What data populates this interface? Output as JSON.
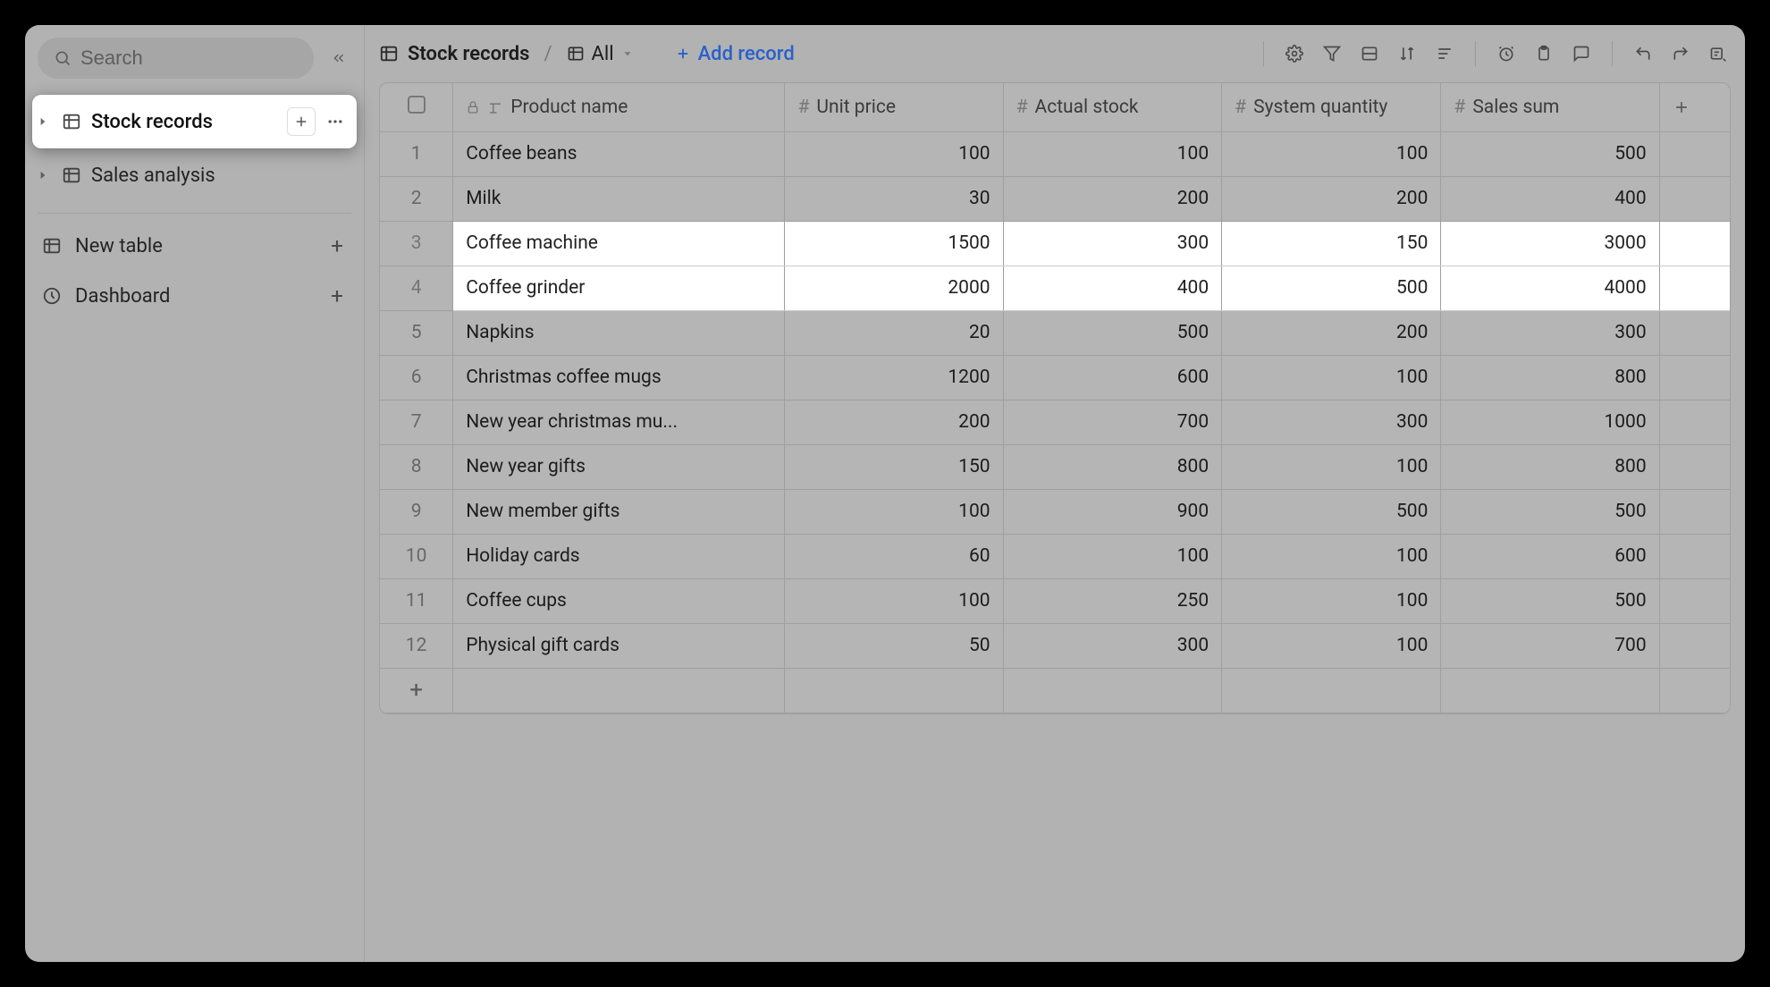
{
  "sidebar": {
    "search_placeholder": "Search",
    "items": [
      {
        "label": "Stock records"
      },
      {
        "label": "Sales analysis"
      }
    ],
    "new_table": "New table",
    "dashboard": "Dashboard"
  },
  "toolbar": {
    "title": "Stock records",
    "view": "All",
    "add_record": "Add record"
  },
  "table": {
    "columns": [
      {
        "label": "Product name"
      },
      {
        "label": "Unit price"
      },
      {
        "label": "Actual stock"
      },
      {
        "label": "System quantity"
      },
      {
        "label": "Sales sum"
      }
    ],
    "rows": [
      {
        "n": "1",
        "name": "Coffee beans",
        "unit": "100",
        "actual": "100",
        "system": "100",
        "sales": "500",
        "hl": false
      },
      {
        "n": "2",
        "name": "Milk",
        "unit": "30",
        "actual": "200",
        "system": "200",
        "sales": "400",
        "hl": false
      },
      {
        "n": "3",
        "name": "Coffee machine",
        "unit": "1500",
        "actual": "300",
        "system": "150",
        "sales": "3000",
        "hl": true
      },
      {
        "n": "4",
        "name": "Coffee grinder",
        "unit": "2000",
        "actual": "400",
        "system": "500",
        "sales": "4000",
        "hl": true
      },
      {
        "n": "5",
        "name": "Napkins",
        "unit": "20",
        "actual": "500",
        "system": "200",
        "sales": "300",
        "hl": false
      },
      {
        "n": "6",
        "name": "Christmas coffee mugs",
        "unit": "1200",
        "actual": "600",
        "system": "100",
        "sales": "800",
        "hl": false
      },
      {
        "n": "7",
        "name": "New year christmas mu...",
        "unit": "200",
        "actual": "700",
        "system": "300",
        "sales": "1000",
        "hl": false
      },
      {
        "n": "8",
        "name": "New year gifts",
        "unit": "150",
        "actual": "800",
        "system": "100",
        "sales": "800",
        "hl": false
      },
      {
        "n": "9",
        "name": "New member gifts",
        "unit": "100",
        "actual": "900",
        "system": "500",
        "sales": "500",
        "hl": false
      },
      {
        "n": "10",
        "name": "Holiday cards",
        "unit": "60",
        "actual": "100",
        "system": "100",
        "sales": "600",
        "hl": false
      },
      {
        "n": "11",
        "name": "Coffee cups",
        "unit": "100",
        "actual": "250",
        "system": "100",
        "sales": "500",
        "hl": false
      },
      {
        "n": "12",
        "name": "Physical gift cards",
        "unit": "50",
        "actual": "300",
        "system": "100",
        "sales": "700",
        "hl": false
      }
    ]
  }
}
